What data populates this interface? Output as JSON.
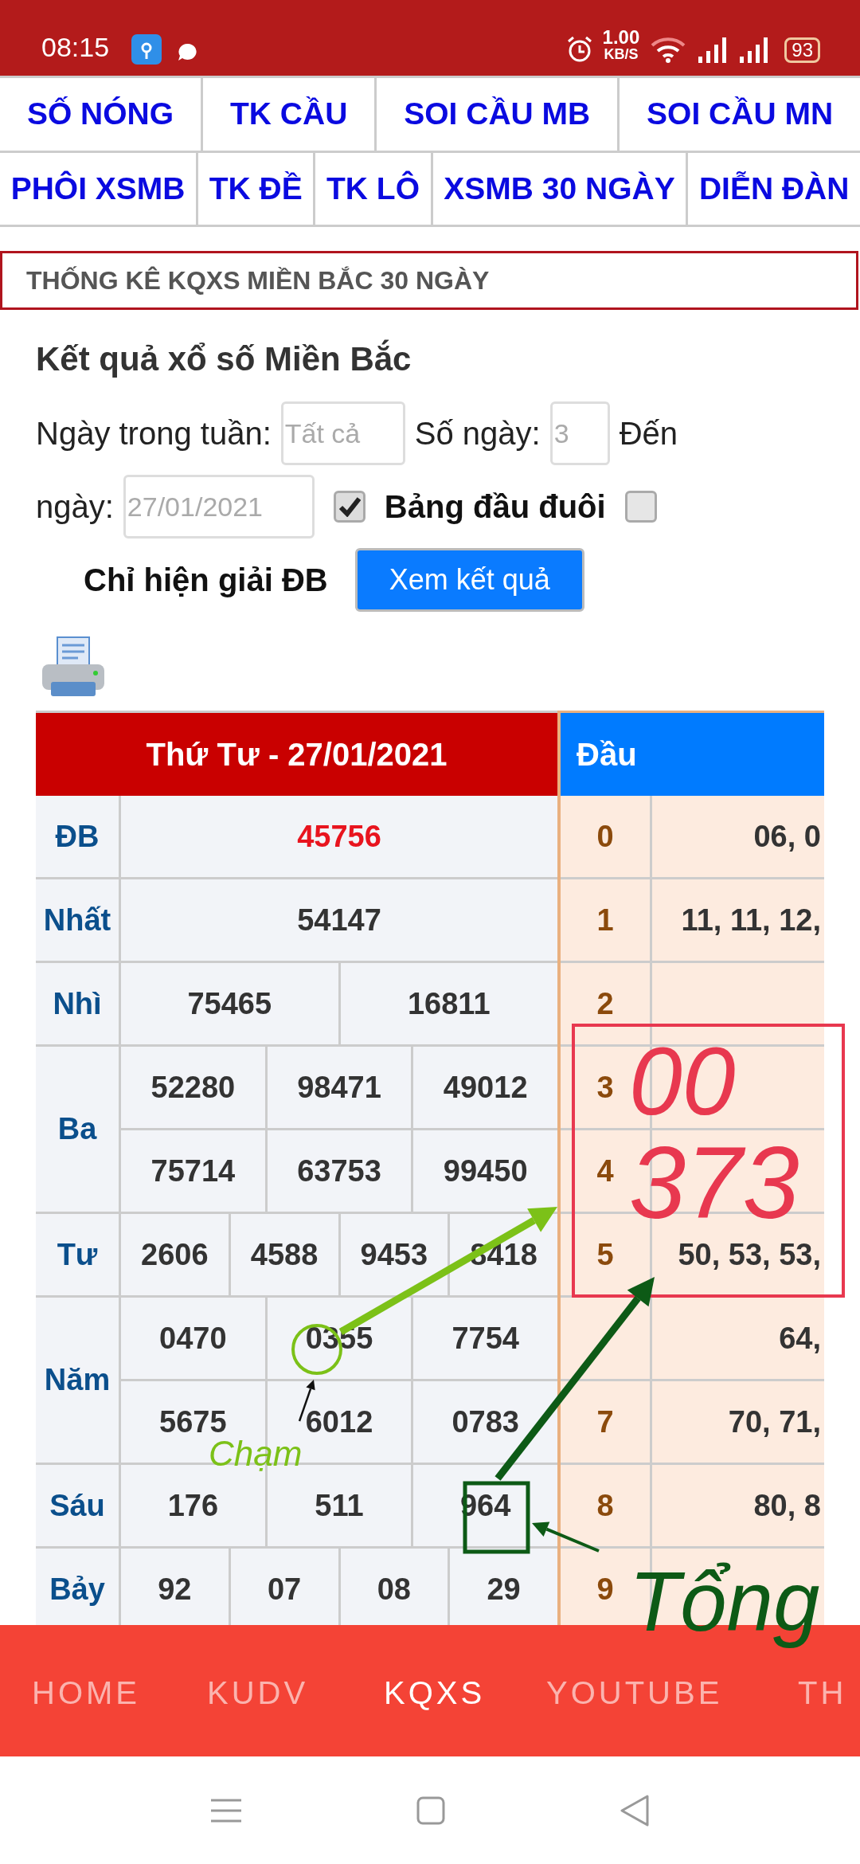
{
  "status_bar": {
    "time": "08:15",
    "speed": "1.00",
    "speed_unit": "KB/S",
    "battery": "93"
  },
  "top_nav": [
    [
      "SỐ NÓNG",
      "TK CẦU",
      "SOI CẦU MB",
      "SOI CẦU MN"
    ],
    [
      "PHÔI XSMB",
      "TK ĐỀ",
      "TK LÔ",
      "XSMB 30 NGÀY",
      "DIỄN ĐÀN"
    ]
  ],
  "section_title": "THỐNG KÊ KQXS MIỀN BẮC 30 NGÀY",
  "heading": "Kết quả xổ số Miền Bắc",
  "form_lines": [
    [
      {
        "kind": "label",
        "text": "Ngày trong tuần:"
      },
      {
        "kind": "input",
        "placeholder": "Tất cả"
      },
      {
        "kind": "label",
        "text": "Số ngày:"
      },
      {
        "kind": "input",
        "placeholder": "3"
      },
      {
        "kind": "label",
        "text": "Đến"
      }
    ],
    [
      {
        "kind": "label",
        "text": "ngày:"
      },
      {
        "kind": "input",
        "placeholder": "27/01/2021"
      },
      {
        "kind": "checkbox",
        "checked": true
      },
      {
        "kind": "bold-label",
        "text": "Bảng đầu đuôi"
      },
      {
        "kind": "checkbox",
        "checked": false
      }
    ],
    [
      {
        "kind": "bold-label",
        "text": "Chỉ hiện giải ĐB"
      },
      {
        "kind": "button",
        "text": "Xem kết quả"
      }
    ]
  ],
  "results": {
    "date_header": "Thứ Tư - 27/01/2021",
    "prizes": [
      {
        "label": "ĐB",
        "special": true,
        "rows": [
          [
            "45756"
          ]
        ]
      },
      {
        "label": "Nhất",
        "special": false,
        "rows": [
          [
            "54147"
          ]
        ]
      },
      {
        "label": "Nhì",
        "special": false,
        "rows": [
          [
            "75465",
            "16811"
          ]
        ]
      },
      {
        "label": "Ba",
        "special": false,
        "rows": [
          [
            "52280",
            "98471",
            "49012"
          ],
          [
            "75714",
            "63753",
            "99450"
          ]
        ]
      },
      {
        "label": "Tư",
        "special": false,
        "rows": [
          [
            "2606",
            "4588",
            "9453",
            "8418"
          ]
        ]
      },
      {
        "label": "Năm",
        "special": false,
        "rows": [
          [
            "0470",
            "0355",
            "7754"
          ],
          [
            "5675",
            "6012",
            "0783"
          ]
        ]
      },
      {
        "label": "Sáu",
        "special": false,
        "rows": [
          [
            "176",
            "511",
            "964"
          ]
        ]
      },
      {
        "label": "Bảy",
        "special": false,
        "rows": [
          [
            "92",
            "07",
            "08",
            "29"
          ]
        ]
      }
    ]
  },
  "head_table": {
    "header": "Đầu",
    "rows": [
      {
        "digit": "0",
        "values": "06, 0"
      },
      {
        "digit": "1",
        "values": "11, 11, 12,"
      },
      {
        "digit": "2"
      },
      {
        "digit": "3"
      },
      {
        "digit": "4"
      },
      {
        "digit": "5",
        "values": "50, 53, 53,"
      },
      {
        "values": "64,"
      },
      {
        "digit": "7",
        "values": "70, 71,"
      },
      {
        "digit": "8",
        "values": "80, 8"
      },
      {
        "digit": "9"
      }
    ]
  },
  "bottom_tabs": [
    {
      "label": "HOME",
      "selected": false
    },
    {
      "label": "KUDV",
      "selected": false
    },
    {
      "label": "KQXS",
      "selected": true
    },
    {
      "label": "YOUTUBE",
      "selected": false
    },
    {
      "label": "TH",
      "selected": false
    }
  ],
  "handwriting": [
    {
      "text": "00",
      "color": "#e8384f"
    },
    {
      "text": "373",
      "color": "#e8384f"
    },
    {
      "text": "Chạm",
      "color": "#7cc118"
    },
    {
      "text": "Tổng",
      "color": "#0d5a16"
    }
  ]
}
